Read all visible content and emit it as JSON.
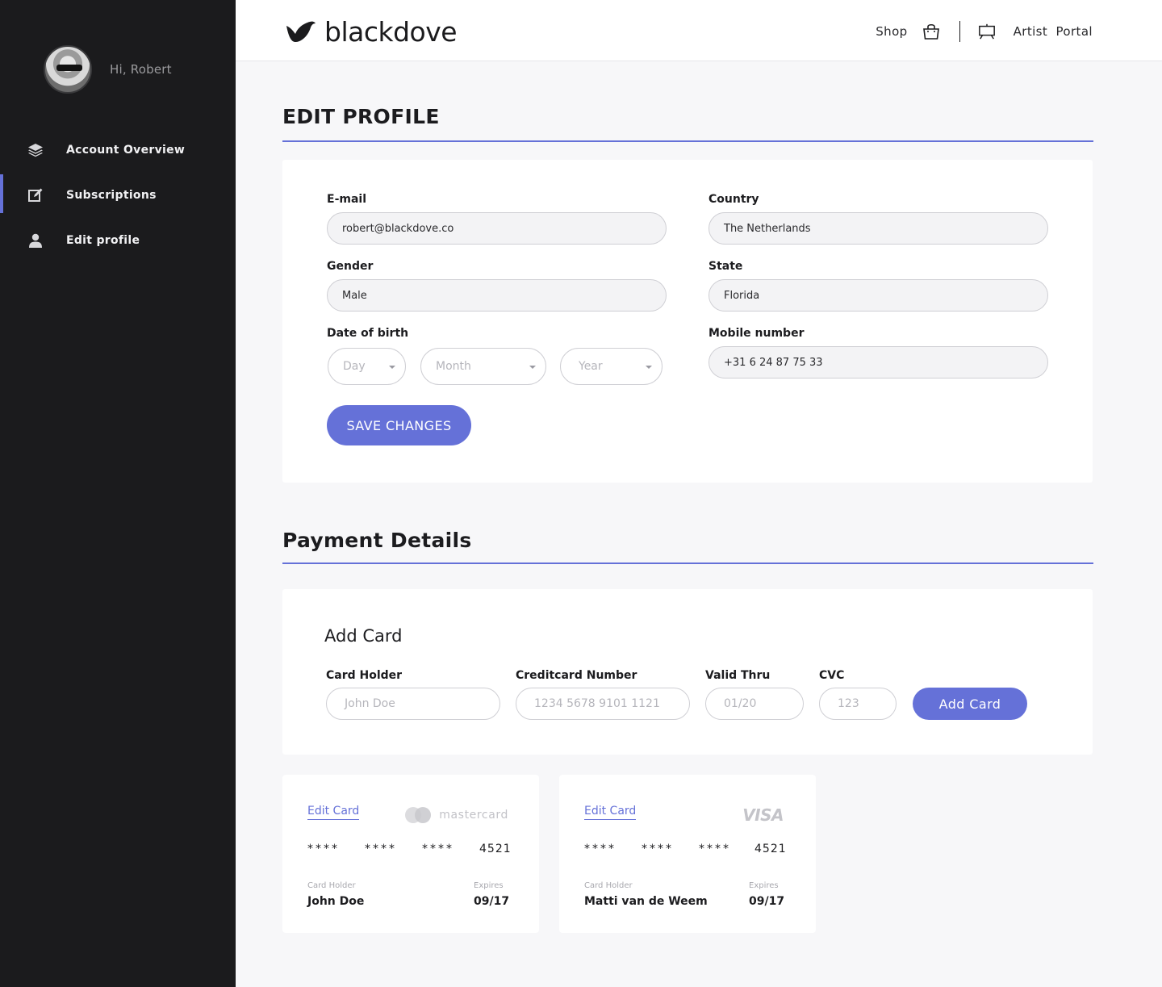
{
  "sidebar": {
    "greeting": "Hi, Robert",
    "items": [
      {
        "label": "Account Overview",
        "icon": "layers-icon"
      },
      {
        "label": "Subscriptions",
        "icon": "edit-square-icon"
      },
      {
        "label": "Edit profile",
        "icon": "user-icon"
      }
    ]
  },
  "header": {
    "logo": "blackdove",
    "shop_label": "Shop",
    "artist_portal_label": "Artist  Portal"
  },
  "edit_profile": {
    "title": "EDIT PROFILE",
    "email_label": "E-mail",
    "email_value": "robert@blackdove.co",
    "gender_label": "Gender",
    "gender_value": "Male",
    "dob_label": "Date of birth",
    "dob_day": "Day",
    "dob_month": "Month",
    "dob_year": "Year",
    "country_label": "Country",
    "country_value": "The Netherlands",
    "state_label": "State",
    "state_value": "Florida",
    "mobile_label": "Mobile number",
    "mobile_value": "+31 6 24 87 75 33",
    "save_label": "SAVE CHANGES"
  },
  "payment": {
    "title": "Payment Details",
    "add_card_title": "Add Card",
    "holder_label": "Card Holder",
    "holder_placeholder": "John Doe",
    "number_label": "Creditcard Number",
    "number_placeholder": "1234 5678 9101 1121",
    "valid_label": "Valid Thru",
    "valid_placeholder": "01/20",
    "cvc_label": "CVC",
    "cvc_placeholder": "123",
    "add_button": "Add Card",
    "cards": [
      {
        "edit": "Edit Card",
        "brand": "mastercard",
        "g1": "****",
        "g2": "****",
        "g3": "****",
        "last4": "4521",
        "holder_label": "Card Holder",
        "holder": "John Doe",
        "expires_label": "Expires",
        "expires": "09/17"
      },
      {
        "edit": "Edit Card",
        "brand": "VISA",
        "g1": "****",
        "g2": "****",
        "g3": "****",
        "last4": "4521",
        "holder_label": "Card Holder",
        "holder": "Matti van de Weem",
        "expires_label": "Expires",
        "expires": "09/17"
      }
    ]
  },
  "colors": {
    "accent": "#6571d8",
    "sidebar": "#1b1b1d",
    "background": "#f7f7f9"
  }
}
